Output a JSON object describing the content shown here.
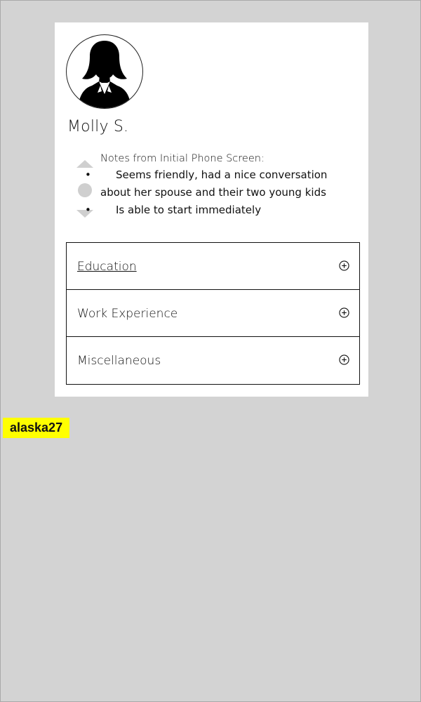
{
  "profile": {
    "name": "Molly S.",
    "avatar_icon": "person-silhouette-icon"
  },
  "notes": {
    "heading": "Notes from Initial Phone Screen:",
    "items": [
      "Seems friendly, had a nice conversation about her spouse and their two young kids",
      "Is able to start immediately"
    ]
  },
  "accordion": {
    "sections": [
      {
        "label": "Education",
        "icon": "plus-circle-icon"
      },
      {
        "label": "Work Experience",
        "icon": "plus-circle-icon"
      },
      {
        "label": "Miscellaneous",
        "icon": "plus-circle-icon"
      }
    ]
  },
  "tag": {
    "label": "alaska27"
  },
  "colors": {
    "background": "#d3d3d3",
    "card": "#ffffff",
    "tag": "#ffff00",
    "scroller": "#cfcfcf"
  }
}
